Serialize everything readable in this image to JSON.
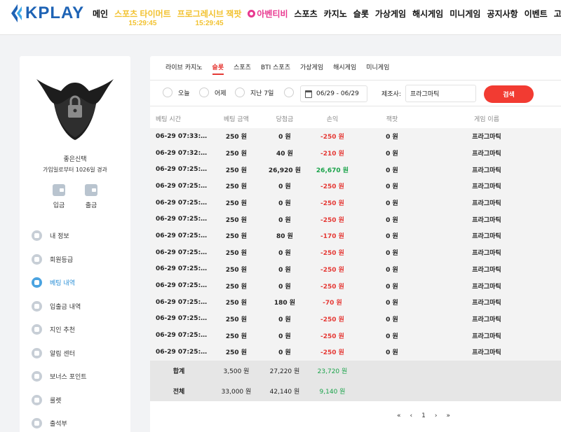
{
  "header": {
    "logo_text": "KPLAY",
    "nav": [
      {
        "label": "메인",
        "style": "plain"
      },
      {
        "label": "스포츠 타이머트",
        "style": "hl",
        "sub": "15:29:45"
      },
      {
        "label": "프로그레시브 잭팟",
        "style": "hl2",
        "sub": "15:29:45"
      },
      {
        "label": "아벤티비",
        "style": "pink"
      },
      {
        "label": "스포츠",
        "style": "plain"
      },
      {
        "label": "카지노",
        "style": "plain"
      },
      {
        "label": "슬롯",
        "style": "plain"
      },
      {
        "label": "가상게임",
        "style": "plain"
      },
      {
        "label": "해시게임",
        "style": "plain"
      },
      {
        "label": "미니게임",
        "style": "plain"
      },
      {
        "label": "공지사항",
        "style": "plain"
      },
      {
        "label": "이벤트",
        "style": "plain"
      },
      {
        "label": "고객센터",
        "style": "plain"
      }
    ]
  },
  "sidebar": {
    "user_name": "좋은신택",
    "member_days": "가입일로부터 1026일 경과",
    "deposit_label": "입금",
    "withdraw_label": "출금",
    "menu": [
      {
        "label": "내 정보",
        "active": false
      },
      {
        "label": "회원등급",
        "active": false
      },
      {
        "label": "베팅 내역",
        "active": true
      },
      {
        "label": "입출금 내역",
        "active": false
      },
      {
        "label": "지인 추천",
        "active": false
      },
      {
        "label": "알림 센터",
        "active": false
      },
      {
        "label": "보너스 포인트",
        "active": false
      },
      {
        "label": "룰렛",
        "active": false
      },
      {
        "label": "출석부",
        "active": false
      }
    ]
  },
  "tabs": [
    {
      "label": "라이브 카지노",
      "active": false
    },
    {
      "label": "슬롯",
      "active": true
    },
    {
      "label": "스포츠",
      "active": false
    },
    {
      "label": "BTI 스포츠",
      "active": false
    },
    {
      "label": "가상게임",
      "active": false
    },
    {
      "label": "해시게임",
      "active": false
    },
    {
      "label": "미니게임",
      "active": false
    }
  ],
  "filter": {
    "today": "오늘",
    "yesterday": "어제",
    "last7": "지난 7일",
    "date_range": "06/29 - 06/29",
    "maker_label": "제조사:",
    "maker_value": "프라그마틱",
    "search_label": "검색"
  },
  "table": {
    "headers": [
      "베팅 시간",
      "베팅 금액",
      "당첨금",
      "손익",
      "잭팟",
      "게임 이름"
    ],
    "rows": [
      [
        "06-29 07:33:…",
        "250 원",
        "0 원",
        "-250 원",
        "0 원",
        "프라그마틱"
      ],
      [
        "06-29 07:32:…",
        "250 원",
        "40 원",
        "-210 원",
        "0 원",
        "프라그마틱"
      ],
      [
        "06-29 07:25:…",
        "250 원",
        "26,920 원",
        "26,670 원",
        "0 원",
        "프라그마틱"
      ],
      [
        "06-29 07:25:…",
        "250 원",
        "0 원",
        "-250 원",
        "0 원",
        "프라그마틱"
      ],
      [
        "06-29 07:25:…",
        "250 원",
        "0 원",
        "-250 원",
        "0 원",
        "프라그마틱"
      ],
      [
        "06-29 07:25:…",
        "250 원",
        "0 원",
        "-250 원",
        "0 원",
        "프라그마틱"
      ],
      [
        "06-29 07:25:…",
        "250 원",
        "80 원",
        "-170 원",
        "0 원",
        "프라그마틱"
      ],
      [
        "06-29 07:25:…",
        "250 원",
        "0 원",
        "-250 원",
        "0 원",
        "프라그마틱"
      ],
      [
        "06-29 07:25:…",
        "250 원",
        "0 원",
        "-250 원",
        "0 원",
        "프라그마틱"
      ],
      [
        "06-29 07:25:…",
        "250 원",
        "0 원",
        "-250 원",
        "0 원",
        "프라그마틱"
      ],
      [
        "06-29 07:25:…",
        "250 원",
        "180 원",
        "-70 원",
        "0 원",
        "프라그마틱"
      ],
      [
        "06-29 07:25:…",
        "250 원",
        "0 원",
        "-250 원",
        "0 원",
        "프라그마틱"
      ],
      [
        "06-29 07:25:…",
        "250 원",
        "0 원",
        "-250 원",
        "0 원",
        "프라그마틱"
      ],
      [
        "06-29 07:25:…",
        "250 원",
        "0 원",
        "-250 원",
        "0 원",
        "프라그마틱"
      ]
    ],
    "summary": [
      [
        "합계",
        "3,500 원",
        "27,220 원",
        "23,720 원"
      ],
      [
        "전체",
        "33,000 원",
        "42,140 원",
        "9,140 원"
      ]
    ]
  },
  "pager": {
    "first": "«",
    "prev": "‹",
    "page": "1",
    "next": "›",
    "last": "»"
  },
  "colors": {
    "accent": "#e53935",
    "positive": "#1aa34a",
    "brand": "#1e63b5",
    "highlight": "#f2c230"
  }
}
